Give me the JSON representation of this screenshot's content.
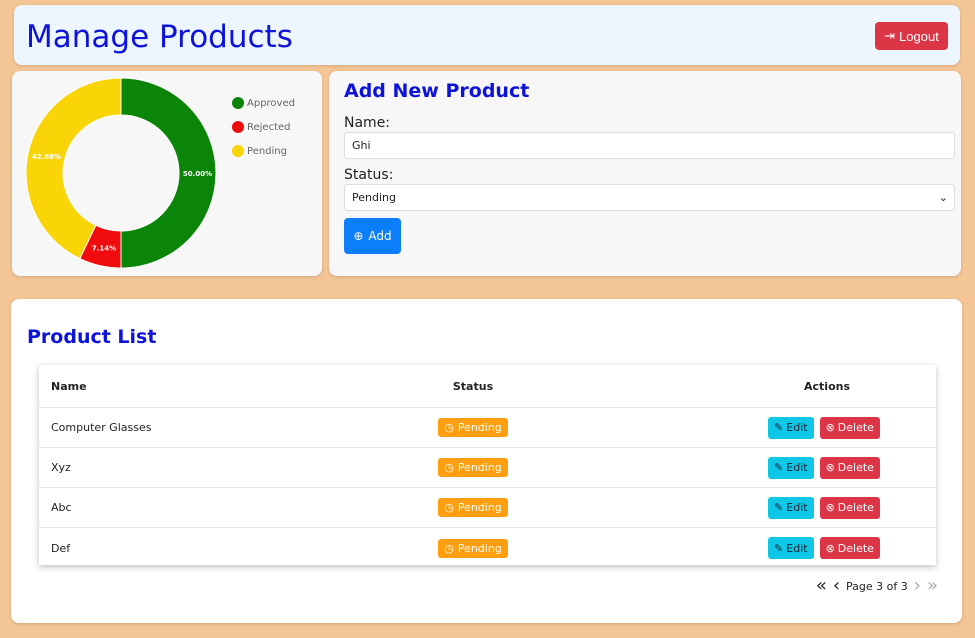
{
  "header": {
    "title": "Manage Products",
    "logout_label": "Logout"
  },
  "chart_data": {
    "type": "pie",
    "categories": [
      "Approved",
      "Rejected",
      "Pending"
    ],
    "values": [
      50.0,
      7.14,
      42.86
    ],
    "labels": [
      "50.00%",
      "7.14%",
      "42.86%"
    ],
    "colors": [
      "#0a8507",
      "#f00c0c",
      "#f9d406"
    ],
    "legend_position": "top-right"
  },
  "form": {
    "title": "Add New Product",
    "name_label": "Name:",
    "name_value": "Ghi",
    "status_label": "Status:",
    "status_value": "Pending",
    "add_label": "Add"
  },
  "list": {
    "title": "Product List",
    "columns": [
      "Name",
      "Status",
      "Actions"
    ],
    "rows": [
      {
        "name": "Computer Glasses",
        "status": "Pending"
      },
      {
        "name": "Xyz",
        "status": "Pending"
      },
      {
        "name": "Abc",
        "status": "Pending"
      },
      {
        "name": "Def",
        "status": "Pending"
      }
    ],
    "edit_label": "Edit",
    "delete_label": "Delete",
    "pagination": "Page 3 of 3"
  }
}
